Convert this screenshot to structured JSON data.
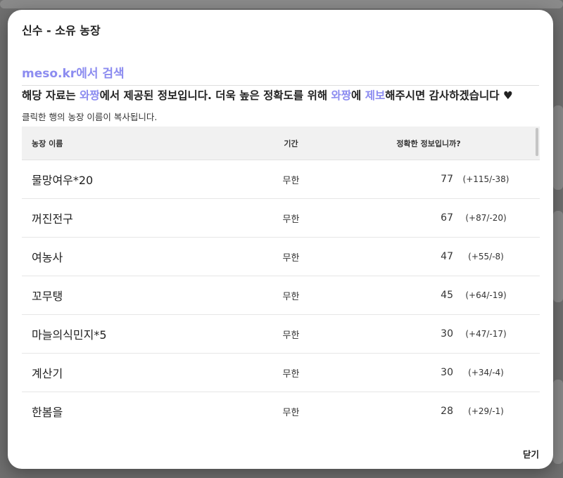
{
  "dialog": {
    "title": "신수 - 소유 농장",
    "search_link": "meso.kr에서 검색",
    "notice": {
      "part1": "해당 자료는 ",
      "source1": "와짱",
      "part2": "에서 제공된 정보입니다. 더욱 높은 정확도를 위해 ",
      "source2": "와짱",
      "part3": "에 ",
      "report": "제보",
      "part4": "해주시면 감사하겠습니다 ",
      "heart": "♥"
    },
    "hint": "클릭한 행의 농장 이름이 복사됩니다.",
    "close_label": "닫기"
  },
  "table": {
    "headers": {
      "name": "농장 이름",
      "period": "기간",
      "accuracy": "정확한 정보입니까?"
    },
    "rows": [
      {
        "name": "물망여우*20",
        "period": "무한",
        "score": "77",
        "votes": "(+115/-38)"
      },
      {
        "name": "꺼진전구",
        "period": "무한",
        "score": "67",
        "votes": "(+87/-20)"
      },
      {
        "name": "여농사",
        "period": "무한",
        "score": "47",
        "votes": "(+55/-8)"
      },
      {
        "name": "꼬무탱",
        "period": "무한",
        "score": "45",
        "votes": "(+64/-19)"
      },
      {
        "name": "마늘의식민지*5",
        "period": "무한",
        "score": "30",
        "votes": "(+47/-17)"
      },
      {
        "name": "계산기",
        "period": "무한",
        "score": "30",
        "votes": "(+34/-4)"
      },
      {
        "name": "한봄을",
        "period": "무한",
        "score": "28",
        "votes": "(+29/-1)"
      }
    ]
  },
  "colors": {
    "accent": "#8c8cf0",
    "overlay": "#7b7b7b"
  }
}
